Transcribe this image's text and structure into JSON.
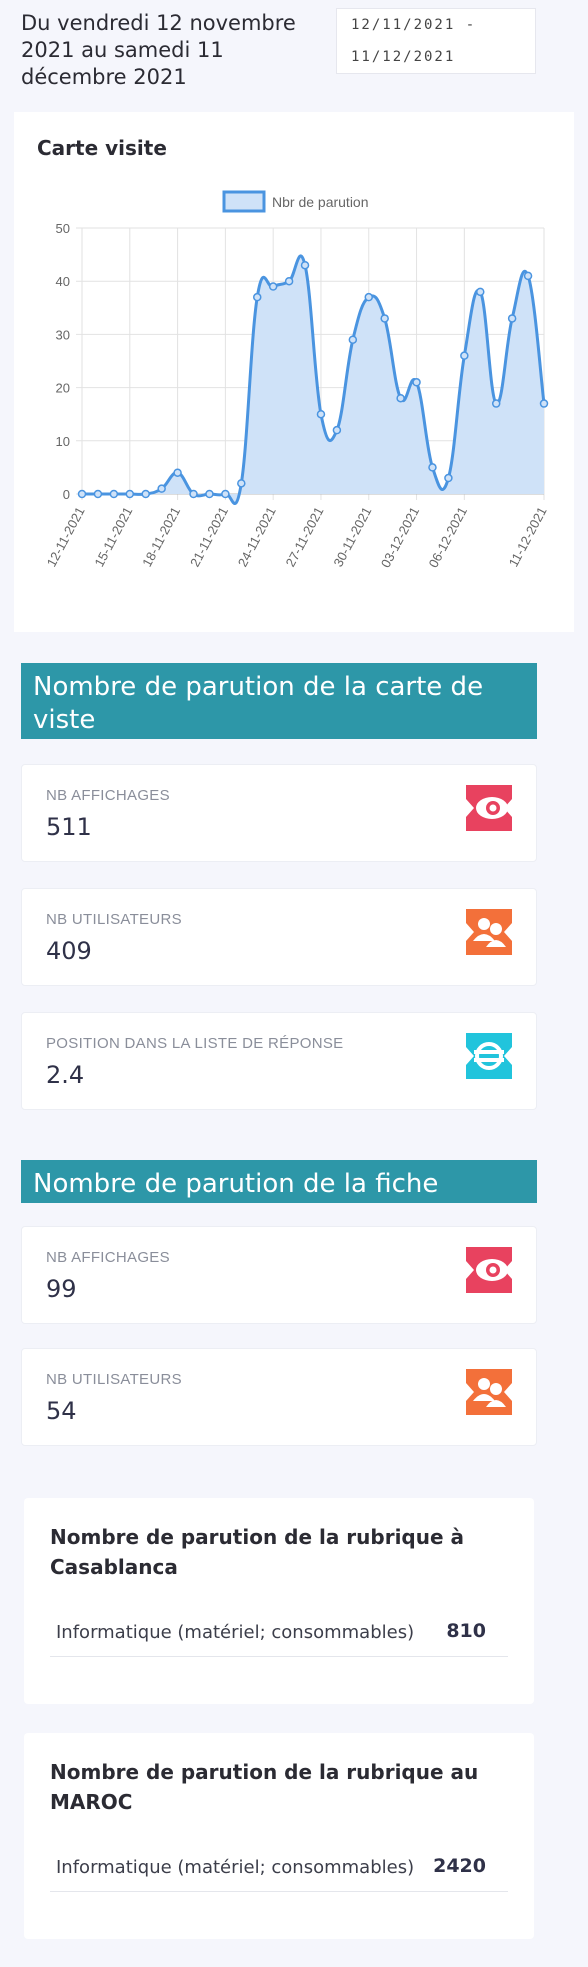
{
  "header": {
    "period_text": "Du vendredi 12 novembre 2021 au samedi 11 décembre 2021",
    "date_range_value": "12/11/2021 - 11/12/2021"
  },
  "chart_card": {
    "title": "Carte visite"
  },
  "chart_data": {
    "type": "area",
    "legend": [
      "Nbr de parution"
    ],
    "legend_position": "top",
    "x_tick_labels": [
      "12-11-2021",
      "15-11-2021",
      "18-11-2021",
      "21-11-2021",
      "24-11-2021",
      "27-11-2021",
      "30-11-2021",
      "03-12-2021",
      "06-12-2021",
      "11-12-2021"
    ],
    "x": [
      "12-11-2021",
      "13-11-2021",
      "14-11-2021",
      "15-11-2021",
      "16-11-2021",
      "17-11-2021",
      "18-11-2021",
      "19-11-2021",
      "20-11-2021",
      "21-11-2021",
      "22-11-2021",
      "23-11-2021",
      "24-11-2021",
      "25-11-2021",
      "26-11-2021",
      "27-11-2021",
      "28-11-2021",
      "29-11-2021",
      "30-11-2021",
      "01-12-2021",
      "02-12-2021",
      "03-12-2021",
      "04-12-2021",
      "05-12-2021",
      "06-12-2021",
      "07-12-2021",
      "08-12-2021",
      "09-12-2021",
      "10-12-2021",
      "11-12-2021"
    ],
    "series": [
      {
        "name": "Nbr de parution",
        "color": "#4a94e0",
        "fill": "#cfe2f8",
        "values": [
          0,
          0,
          0,
          0,
          0,
          1,
          4,
          0,
          0,
          0,
          2,
          37,
          39,
          40,
          43,
          15,
          12,
          29,
          37,
          33,
          18,
          21,
          5,
          3,
          26,
          38,
          17,
          33,
          41,
          17
        ]
      }
    ],
    "ylim": [
      0,
      50
    ],
    "y_ticks": [
      0,
      10,
      20,
      30,
      40,
      50
    ],
    "grid": true
  },
  "section_carte": {
    "title": "Nombre de parution de la carte de viste",
    "stats": [
      {
        "label": "NB AFFICHAGES",
        "value": "511",
        "icon": "eye-icon",
        "color": "#e8425f"
      },
      {
        "label": "NB UTILISATEURS",
        "value": "409",
        "icon": "users-icon",
        "color": "#f3703a"
      },
      {
        "label": "POSITION DANS LA LISTE DE RÉPONSE",
        "value": "2.4",
        "icon": "list-position-icon",
        "color": "#21c4dc"
      }
    ]
  },
  "section_fiche": {
    "title": "Nombre de parution de la fiche",
    "stats": [
      {
        "label": "NB AFFICHAGES",
        "value": "99",
        "icon": "eye-icon",
        "color": "#e8425f"
      },
      {
        "label": "NB UTILISATEURS",
        "value": "54",
        "icon": "users-icon",
        "color": "#f3703a"
      }
    ]
  },
  "rubrique_casablanca": {
    "title": "Nombre de parution de la rubrique à Casablanca",
    "rows": [
      {
        "category": "Informatique (matériel; consommables)",
        "count": "810"
      }
    ]
  },
  "rubrique_maroc": {
    "title": "Nombre de parution de la rubrique au MAROC",
    "rows": [
      {
        "category": "Informatique (matériel; consommables)",
        "count": "2420"
      }
    ]
  }
}
